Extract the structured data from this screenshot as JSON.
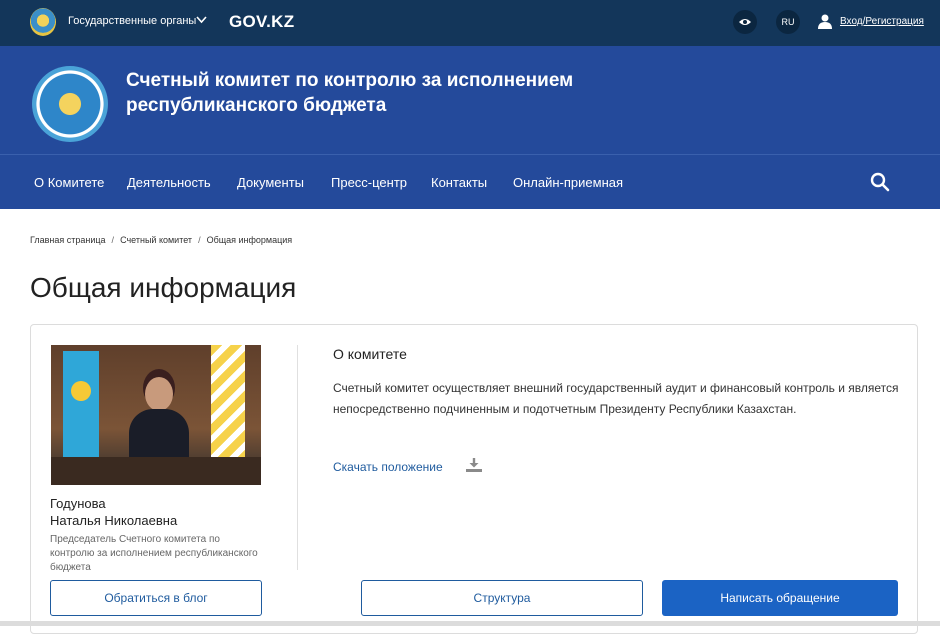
{
  "topbar": {
    "gov_bodies_label": "Государственные органы",
    "govkz_label": "GOV.KZ",
    "lang_label": "RU",
    "login_label": "Вход/Регистрация",
    "icons": {
      "emblem": "kz-emblem-icon",
      "chevron": "chevron-down-icon",
      "eye": "eye-icon",
      "user": "user-icon"
    }
  },
  "header": {
    "title": "Счетный комитет по контролю за исполнением республиканского бюджета"
  },
  "nav": {
    "items": [
      "О Комитете",
      "Деятельность",
      "Документы",
      "Пресс-центр",
      "Контакты",
      "Онлайн-приемная"
    ]
  },
  "breadcrumbs": [
    "Главная страница",
    "Счетный комитет",
    "Общая информация"
  ],
  "page": {
    "title": "Общая информация"
  },
  "profile": {
    "name_line1": "Годунова",
    "name_line2": "Наталья Николаевна",
    "role": "Председатель Счетного комитета по контролю за исполнением республиканского бюджета",
    "blog_button": "Обратиться в блог"
  },
  "about": {
    "title": "О комитете",
    "text": "Счетный комитет осуществляет внешний государственный аудит и финансовый контроль и является непосредственно подчиненным и подотчетным Президенту Республики Казахстан.",
    "download_label": "Скачать положение",
    "structure_button": "Структура",
    "appeal_button": "Написать обращение"
  },
  "colors": {
    "topbar": "#13365a",
    "header": "#244a9b",
    "primary_button": "#1b63c4",
    "link": "#1f5b9e"
  }
}
